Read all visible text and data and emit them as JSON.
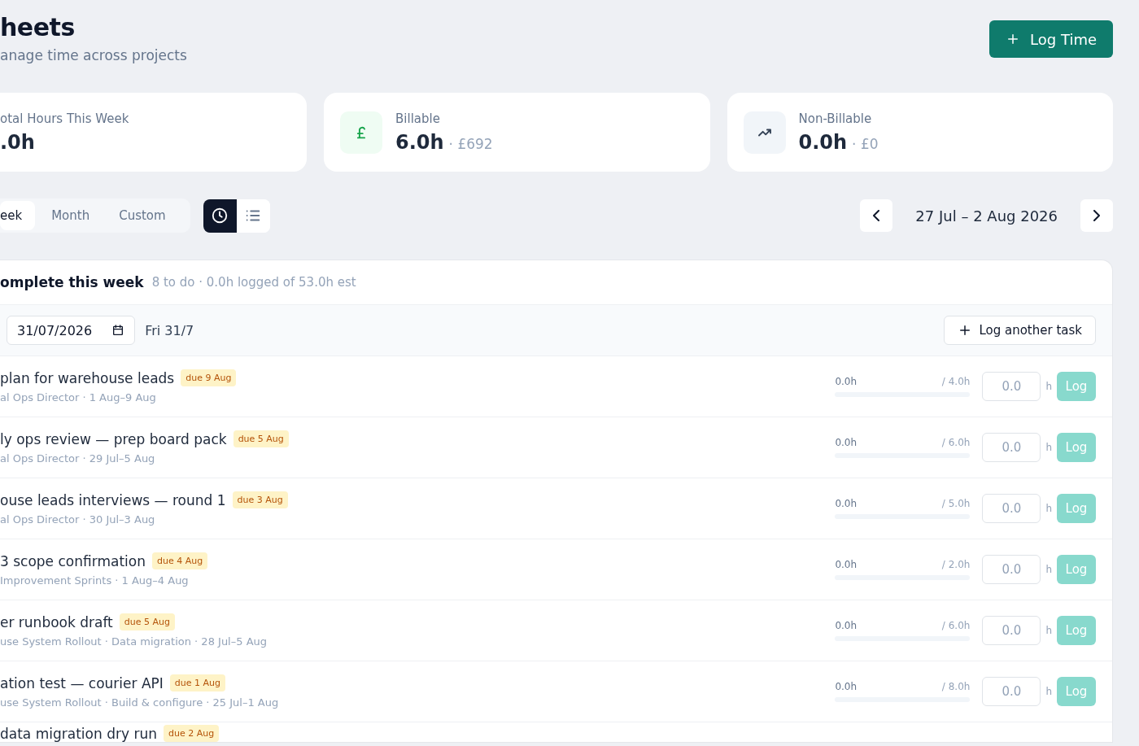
{
  "header": {
    "title": "heets",
    "subtitle": "anage time across projects",
    "action": {
      "label": "Log Time"
    }
  },
  "stats": [
    {
      "kind": "plain",
      "label": "otal Hours This Week",
      "value": ".0h"
    },
    {
      "kind": "billable",
      "label": "Billable",
      "value": "6.0h",
      "amount": "· £692"
    },
    {
      "kind": "trend",
      "label": "Non-Billable",
      "value": "0.0h",
      "amount": "· £0"
    }
  ],
  "period_tabs": [
    {
      "label": "eek",
      "selected": true
    },
    {
      "label": "Month",
      "selected": false
    },
    {
      "label": "Custom",
      "selected": false
    }
  ],
  "view_toggle": [
    {
      "kind": "clock",
      "selected": true
    },
    {
      "kind": "list",
      "selected": false
    }
  ],
  "date_range": "27 Jul – 2 Aug 2026",
  "panel": {
    "title": "omplete this week",
    "summary": "8 to do · 0.0h logged of 53.0h est",
    "date_field": {
      "value": "31/07/2026"
    },
    "day_label": "Fri 31/7",
    "add_button": "Log another task",
    "tasks": [
      {
        "title": "plan for warehouse leads",
        "due": "due 9 Aug",
        "meta": "al Ops Director · 1 Aug–9 Aug",
        "logged": "0.0h",
        "estimate": "/ 4.0h",
        "level": 0,
        "hours": {
          "placeholder": "0.0"
        },
        "unit": "h",
        "button": {
          "label": "Log",
          "disabled": true
        }
      },
      {
        "title": "ly ops review — prep board pack",
        "due": "due 5 Aug",
        "meta": "al Ops Director · 29 Jul–5 Aug",
        "logged": "0.0h",
        "estimate": "/ 6.0h",
        "level": 0,
        "hours": {
          "placeholder": "0.0"
        },
        "unit": "h",
        "button": {
          "label": "Log",
          "disabled": true
        }
      },
      {
        "title": "ouse leads interviews — round 1",
        "due": "due 3 Aug",
        "meta": "al Ops Director · 30 Jul–3 Aug",
        "logged": "0.0h",
        "estimate": "/ 5.0h",
        "level": 0,
        "hours": {
          "placeholder": "0.0"
        },
        "unit": "h",
        "button": {
          "label": "Log",
          "disabled": true
        }
      },
      {
        "title": "3 scope confirmation",
        "due": "due 4 Aug",
        "meta": "Improvement Sprints · 1 Aug–4 Aug",
        "logged": "0.0h",
        "estimate": "/ 2.0h",
        "level": 0,
        "hours": {
          "placeholder": "0.0"
        },
        "unit": "h",
        "button": {
          "label": "Log",
          "disabled": true
        }
      },
      {
        "title": "er runbook draft",
        "due": "due 5 Aug",
        "meta": "use System Rollout · Data migration · 28 Jul–5 Aug",
        "logged": "0.0h",
        "estimate": "/ 6.0h",
        "level": 0,
        "hours": {
          "placeholder": "0.0"
        },
        "unit": "h",
        "button": {
          "label": "Log",
          "disabled": true
        }
      },
      {
        "title": "ation test — courier API",
        "due": "due 1 Aug",
        "meta": "use System Rollout · Build & configure · 25 Jul–1 Aug",
        "logged": "0.0h",
        "estimate": "/ 8.0h",
        "level": 0,
        "hours": {
          "placeholder": "0.0"
        },
        "unit": "h",
        "button": {
          "label": "Log",
          "disabled": true
        }
      },
      {
        "title": "data migration dry run",
        "due": "due 2 Aug"
      }
    ]
  }
}
